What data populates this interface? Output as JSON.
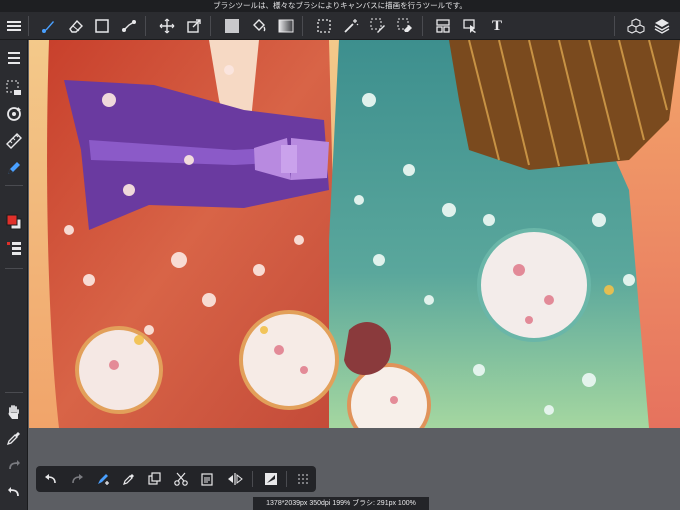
{
  "hint_text": "ブラシツールは、様々なブラシによりキャンバスに描画を行うツールです。",
  "canvas_info": "1378*2039px 350dpi 199% ブラシ: 291px 100%",
  "top_toolbar": {
    "left_icons": [
      "menu-icon",
      "brush-icon",
      "eraser-icon",
      "square-icon",
      "dot-line-icon"
    ],
    "transform_icons": [
      "move-icon",
      "transform-icon"
    ],
    "fill_icons": [
      "fill-color-icon",
      "bucket-icon",
      "gradient-icon"
    ],
    "select_icons": [
      "select-rect-icon",
      "magic-wand-icon",
      "select-pen-icon",
      "select-eraser-icon"
    ],
    "misc_icons": [
      "panel-icon",
      "operation-icon",
      "text-icon"
    ],
    "right_icons": [
      "materials-icon",
      "layers-icon"
    ],
    "text_tool_label": "T"
  },
  "left_toolbar": {
    "icons": [
      "brush-panel-icon",
      "selection-panel-icon",
      "rotate-icon",
      "ruler-icon",
      "pen-icon",
      "color-icon",
      "layer-list-icon",
      "hand-icon",
      "eyedropper-icon",
      "redo-icon",
      "undo-icon"
    ]
  },
  "float_toolbar": {
    "icons": [
      "undo-icon",
      "redo-icon",
      "transform-brush-icon",
      "eyedropper-icon",
      "duplicate-icon",
      "cut-icon",
      "paste-icon",
      "flip-icon",
      "canvas-icon",
      "grid-icon"
    ]
  },
  "colors": {
    "toolbar_bg": "#2b2c30",
    "accent": "#4aa0ff",
    "workspace_grey": "#5c5e63",
    "primary_color": "#e0302a"
  }
}
